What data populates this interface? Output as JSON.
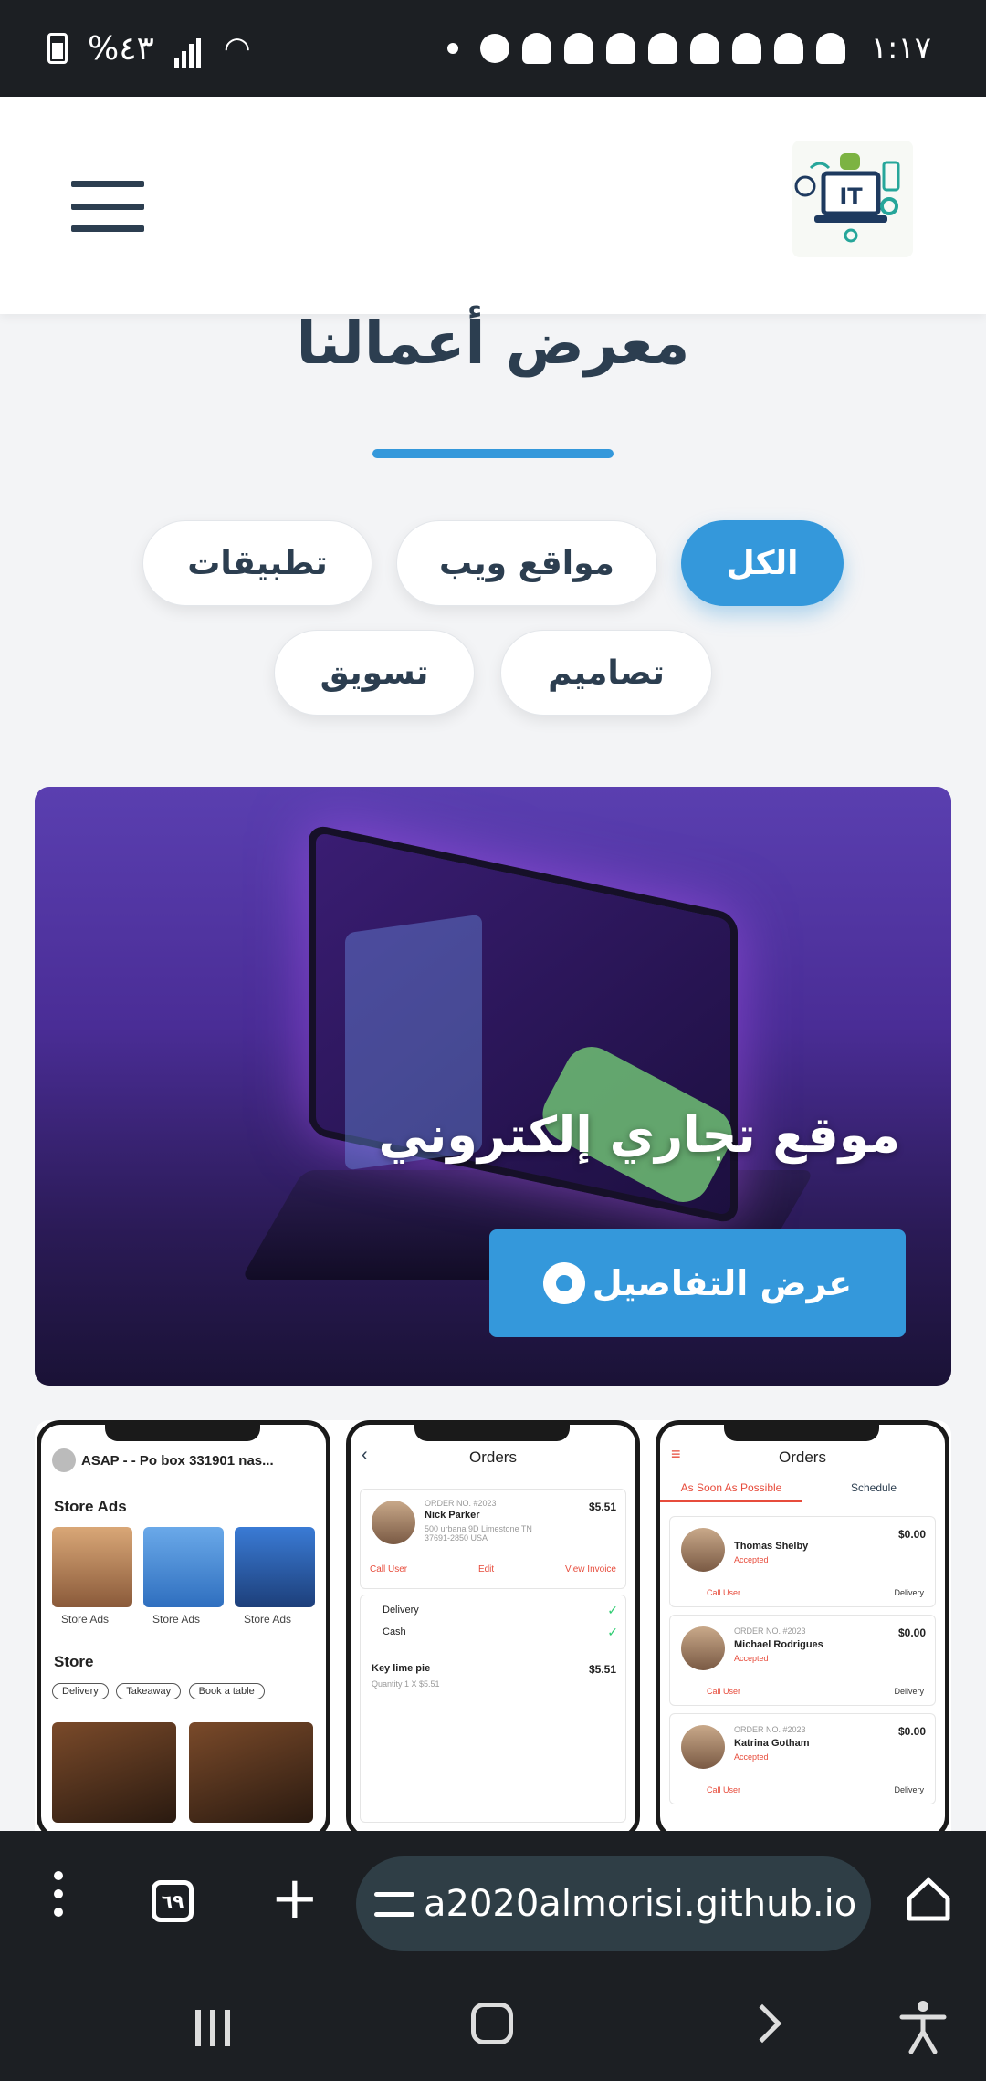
{
  "status_bar": {
    "time": "١:١٧",
    "battery_text": "%٤٣"
  },
  "header": {
    "menu_icon": "hamburger-icon",
    "logo_icon": "it-logo"
  },
  "section": {
    "title": "معرض أعمالنا"
  },
  "filters": [
    {
      "label": "الكل",
      "active": true
    },
    {
      "label": "مواقع ويب",
      "active": false
    },
    {
      "label": "تطبيقات",
      "active": false
    },
    {
      "label": "تصاميم",
      "active": false
    },
    {
      "label": "تسويق",
      "active": false
    }
  ],
  "portfolio": [
    {
      "title": "موقع تجاري إلكتروني",
      "button_label": "عرض التفاصيل"
    },
    {
      "mockup": {
        "phone1": {
          "address": "ASAP - - Po box 331901 nas...",
          "store_ads_heading": "Store Ads",
          "store_ads_labels": [
            "Store Ads",
            "Store Ads",
            "Store Ads"
          ],
          "store_heading": "Store",
          "chips": [
            "Delivery",
            "Takeaway",
            "Book a table"
          ]
        },
        "phone2": {
          "title": "Orders",
          "order_no": "ORDER NO. #2023",
          "customer": "Nick Parker",
          "address": "500 urbana 9D Limestone TN 37691-2850 USA",
          "price": "$5.51",
          "actions": [
            "Call User",
            "Edit",
            "View Invoice"
          ],
          "delivery": "Delivery",
          "cash": "Cash",
          "item": "Key lime pie",
          "item_qty": "Quantity 1 X $5.51",
          "item_price": "$5.51"
        },
        "phone3": {
          "title": "Orders",
          "tabs": [
            "As Soon As Possible",
            "Schedule"
          ],
          "orders": [
            {
              "name": "Thomas Shelby",
              "status": "Accepted",
              "price": "$0.00",
              "order_no": ""
            },
            {
              "name": "Michael Rodrigues",
              "status": "Accepted",
              "price": "$0.00",
              "order_no": "ORDER NO. #2023"
            },
            {
              "name": "Katrina Gotham",
              "status": "Accepted",
              "price": "$0.00",
              "order_no": "ORDER NO. #2023"
            }
          ],
          "call_label": "Call User",
          "delivery_label": "Delivery"
        }
      }
    }
  ],
  "browser": {
    "tabs_count": "٦٩",
    "url": "a2020almorisi.github.io"
  },
  "colors": {
    "accent": "#3498db",
    "dark_text": "#2c3e50",
    "bar_bg": "#1c1f23"
  }
}
